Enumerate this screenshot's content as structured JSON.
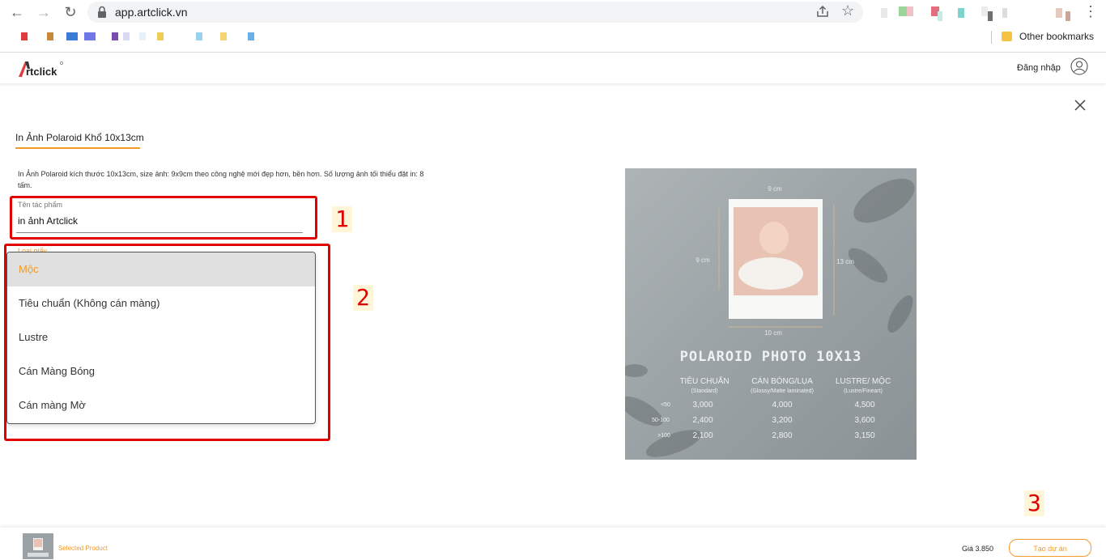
{
  "browser": {
    "url": "app.artclick.vn",
    "other_bookmarks": "Other bookmarks",
    "extension_colors": [
      "#e8e8e8",
      "#9ad59a",
      "#f3c0c8",
      "#e66d7e",
      "#c9ebe7",
      "#7cd4cd",
      "#ececec",
      "#707070",
      "#dcdcdc",
      "#e8c9c0",
      "#c9a59a"
    ],
    "bookmark_colors": [
      "#e23b3b",
      "#c7893a",
      "#3a7bd5",
      "#6f78e6",
      "#7a4cb0",
      "#d9d9f2",
      "#e6f2fb",
      "#f0cb56",
      "#9ad0f0",
      "#f3d373",
      "#6ab0e6"
    ]
  },
  "header": {
    "logo_text": "Artclick",
    "login_label": "Đăng nhập"
  },
  "product": {
    "tab_title": "In Ảnh Polaroid Khổ 10x13cm",
    "description": "In Ảnh Polaroid kích thước 10x13cm, size ảnh: 9x9cm theo công nghệ mới đẹp hơn, bền hơn. Số lượng ảnh tối thiểu đặt in: 8 tấm.",
    "name_field": {
      "label": "Tên tác phẩm",
      "value": "in ảnh Artclick"
    },
    "paper_type": {
      "label": "Loại giấy",
      "options": [
        "Mộc",
        "Tiêu chuẩn (Không cán màng)",
        "Lustre",
        "Cán Màng Bóng",
        "Cán màng Mờ"
      ],
      "selected_index": 0
    }
  },
  "annotations": {
    "markers": [
      "1",
      "2",
      "3"
    ],
    "color": "#e00000"
  },
  "image": {
    "dim_top": "9 cm",
    "dim_left": "9 cm",
    "dim_right": "13 cm",
    "dim_bottom": "10 cm",
    "title": "POLAROID PHOTO 10X13",
    "columns": [
      {
        "label": "TIÊU CHUẨN",
        "sub": "(Standard)"
      },
      {
        "label": "CÁN BÓNG/LỤA",
        "sub": "(Glossy/Matte laminated)"
      },
      {
        "label": "LUSTRE/ MỘC",
        "sub": "(Lustre/Fineart)"
      }
    ],
    "rows": [
      {
        "qty": "<50",
        "values": [
          "3,000",
          "4,000",
          "4,500"
        ]
      },
      {
        "qty": "50-100",
        "values": [
          "2,400",
          "3,200",
          "3,600"
        ]
      },
      {
        "qty": ">100",
        "values": [
          "2,100",
          "2,800",
          "3,150"
        ]
      }
    ]
  },
  "footer": {
    "selected_product": "Selected Product",
    "price": "Giá 3.850",
    "create_button": "Tạo dự án"
  },
  "colors": {
    "accent": "#f39a28",
    "highlight": "#e00000"
  }
}
